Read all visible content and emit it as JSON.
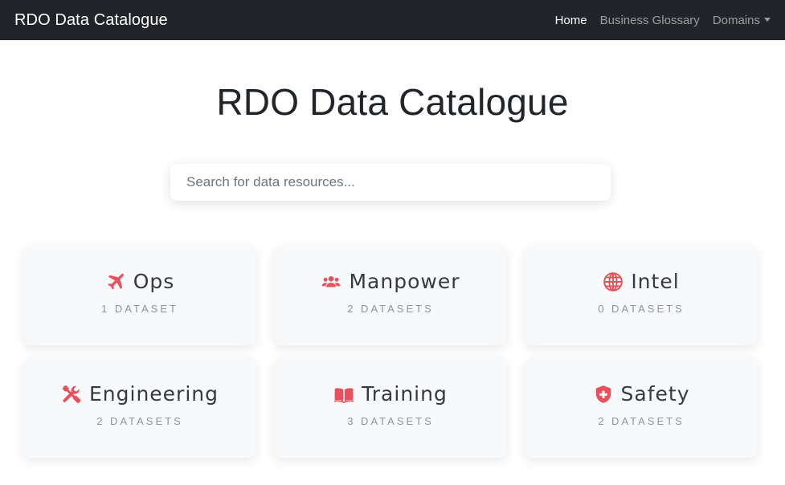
{
  "navbar": {
    "brand": "RDO Data Catalogue",
    "links": [
      {
        "label": "Home",
        "active": true
      },
      {
        "label": "Business Glossary",
        "active": false
      },
      {
        "label": "Domains",
        "active": false
      }
    ]
  },
  "hero": {
    "title": "RDO Data Catalogue",
    "search_placeholder": "Search for data resources..."
  },
  "colors": {
    "navbar_bg": "#212529",
    "icon_accent": "#e8505b",
    "card_bg": "#f8f9fb"
  },
  "domains": [
    {
      "name": "Ops",
      "count": "1 DATASET",
      "icon": "plane-icon"
    },
    {
      "name": "Manpower",
      "count": "2 DATASETS",
      "icon": "users-icon"
    },
    {
      "name": "Intel",
      "count": "0 DATASETS",
      "icon": "globe-icon"
    },
    {
      "name": "Engineering",
      "count": "2 DATASETS",
      "icon": "tools-icon"
    },
    {
      "name": "Training",
      "count": "3 DATASETS",
      "icon": "book-icon"
    },
    {
      "name": "Safety",
      "count": "2 DATASETS",
      "icon": "shield-icon"
    }
  ]
}
